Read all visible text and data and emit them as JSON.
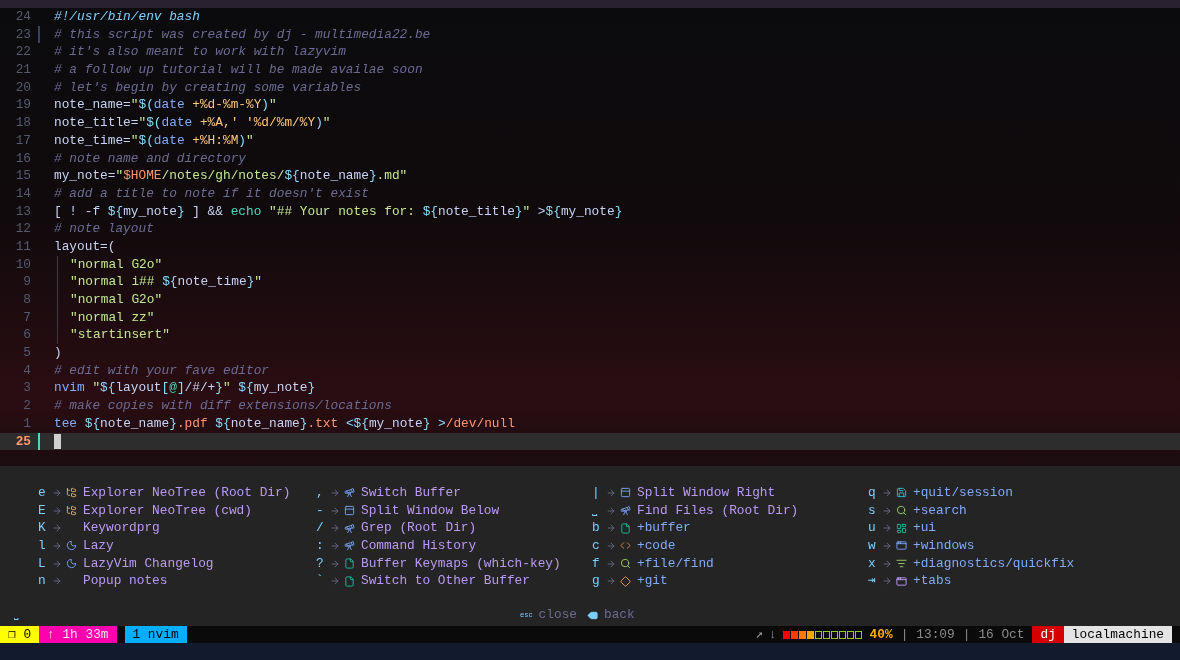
{
  "editor": {
    "lines": [
      {
        "number": "24",
        "tokens": [
          {
            "kind": "shebang",
            "text": "#!/usr/bin/env bash"
          }
        ]
      },
      {
        "number": "23",
        "sign": true,
        "tokens": [
          {
            "kind": "comment",
            "text": "# this script was created by dj - multimedia22.be"
          }
        ]
      },
      {
        "number": "22",
        "tokens": [
          {
            "kind": "comment",
            "text": "# it's also meant to work with lazyvim"
          }
        ]
      },
      {
        "number": "21",
        "tokens": [
          {
            "kind": "comment",
            "text": "# a follow up tutorial will be made availae soon"
          }
        ]
      },
      {
        "number": "20",
        "tokens": [
          {
            "kind": "comment",
            "text": "# let's begin by creating some variables"
          }
        ]
      },
      {
        "number": "19",
        "tokens": [
          {
            "kind": "ident",
            "text": "note_name="
          },
          {
            "kind": "string",
            "text": "\""
          },
          {
            "kind": "op",
            "text": "$("
          },
          {
            "kind": "command",
            "text": "date"
          },
          {
            "kind": "arg",
            "text": " +%d-%m-%Y"
          },
          {
            "kind": "op",
            "text": ")"
          },
          {
            "kind": "string",
            "text": "\""
          }
        ]
      },
      {
        "number": "18",
        "tokens": [
          {
            "kind": "ident",
            "text": "note_title="
          },
          {
            "kind": "string",
            "text": "\""
          },
          {
            "kind": "op",
            "text": "$("
          },
          {
            "kind": "command",
            "text": "date"
          },
          {
            "kind": "arg",
            "text": " +%A,' '%d/%m/%Y"
          },
          {
            "kind": "op",
            "text": ")"
          },
          {
            "kind": "string",
            "text": "\""
          }
        ]
      },
      {
        "number": "17",
        "tokens": [
          {
            "kind": "ident",
            "text": "note_time="
          },
          {
            "kind": "string",
            "text": "\""
          },
          {
            "kind": "op",
            "text": "$("
          },
          {
            "kind": "command",
            "text": "date"
          },
          {
            "kind": "arg",
            "text": " +%H:%M"
          },
          {
            "kind": "op",
            "text": ")"
          },
          {
            "kind": "string",
            "text": "\""
          }
        ]
      },
      {
        "number": "16",
        "tokens": [
          {
            "kind": "comment",
            "text": "# note name and directory"
          }
        ]
      },
      {
        "number": "15",
        "tokens": [
          {
            "kind": "ident",
            "text": "my_note="
          },
          {
            "kind": "string",
            "text": "\""
          },
          {
            "kind": "special",
            "text": "$HOME"
          },
          {
            "kind": "string",
            "text": "/notes/gh/notes/"
          },
          {
            "kind": "op",
            "text": "${"
          },
          {
            "kind": "ident",
            "text": "note_name"
          },
          {
            "kind": "op",
            "text": "}"
          },
          {
            "kind": "string",
            "text": ".md\""
          }
        ]
      },
      {
        "number": "14",
        "tokens": [
          {
            "kind": "comment",
            "text": "# add a title to note if it doesn't exist"
          }
        ]
      },
      {
        "number": "13",
        "tokens": [
          {
            "kind": "ident",
            "text": "[ ! -f "
          },
          {
            "kind": "op",
            "text": "${"
          },
          {
            "kind": "ident",
            "text": "my_note"
          },
          {
            "kind": "op",
            "text": "}"
          },
          {
            "kind": "ident",
            "text": " ] && "
          },
          {
            "kind": "builtin",
            "text": "echo"
          },
          {
            "kind": "string",
            "text": " \"## Your notes for: "
          },
          {
            "kind": "op",
            "text": "${"
          },
          {
            "kind": "ident",
            "text": "note_title"
          },
          {
            "kind": "op",
            "text": "}"
          },
          {
            "kind": "string",
            "text": "\""
          },
          {
            "kind": "ident",
            "text": " >"
          },
          {
            "kind": "op",
            "text": "${"
          },
          {
            "kind": "ident",
            "text": "my_note"
          },
          {
            "kind": "op",
            "text": "}"
          }
        ]
      },
      {
        "number": "12",
        "tokens": [
          {
            "kind": "comment",
            "text": "# note layout"
          }
        ]
      },
      {
        "number": "11",
        "tokens": [
          {
            "kind": "ident",
            "text": "layout=("
          }
        ]
      },
      {
        "number": "10",
        "indented": true,
        "tokens": [
          {
            "kind": "string",
            "text": "\"normal G2o\""
          }
        ]
      },
      {
        "number": "9",
        "indented": true,
        "tokens": [
          {
            "kind": "string",
            "text": "\"normal i## "
          },
          {
            "kind": "op",
            "text": "${"
          },
          {
            "kind": "ident",
            "text": "note_time"
          },
          {
            "kind": "op",
            "text": "}"
          },
          {
            "kind": "string",
            "text": "\""
          }
        ]
      },
      {
        "number": "8",
        "indented": true,
        "tokens": [
          {
            "kind": "string",
            "text": "\"normal G2o\""
          }
        ]
      },
      {
        "number": "7",
        "indented": true,
        "tokens": [
          {
            "kind": "string",
            "text": "\"normal zz\""
          }
        ]
      },
      {
        "number": "6",
        "indented": true,
        "tokens": [
          {
            "kind": "string",
            "text": "\"startinsert\""
          }
        ]
      },
      {
        "number": "5",
        "tokens": [
          {
            "kind": "ident",
            "text": ")"
          }
        ]
      },
      {
        "number": "4",
        "tokens": [
          {
            "kind": "comment",
            "text": "# edit with your fave editor"
          }
        ]
      },
      {
        "number": "3",
        "tokens": [
          {
            "kind": "command",
            "text": "nvim"
          },
          {
            "kind": "string",
            "text": " \""
          },
          {
            "kind": "op",
            "text": "${"
          },
          {
            "kind": "ident",
            "text": "layout"
          },
          {
            "kind": "op",
            "text": "["
          },
          {
            "kind": "builtin",
            "text": "@"
          },
          {
            "kind": "op",
            "text": "]"
          },
          {
            "kind": "ident",
            "text": "/#/+"
          },
          {
            "kind": "op",
            "text": "}"
          },
          {
            "kind": "string",
            "text": "\""
          },
          {
            "kind": "op",
            "text": " ${"
          },
          {
            "kind": "ident",
            "text": "my_note"
          },
          {
            "kind": "op",
            "text": "}"
          }
        ]
      },
      {
        "number": "2",
        "tokens": [
          {
            "kind": "comment",
            "text": "# make copies with diff extensions/locations"
          }
        ]
      },
      {
        "number": "1",
        "tokens": [
          {
            "kind": "command",
            "text": "tee"
          },
          {
            "kind": "op",
            "text": " ${"
          },
          {
            "kind": "ident",
            "text": "note_name"
          },
          {
            "kind": "op",
            "text": "}"
          },
          {
            "kind": "special",
            "text": ".pdf"
          },
          {
            "kind": "op",
            "text": " ${"
          },
          {
            "kind": "ident",
            "text": "note_name"
          },
          {
            "kind": "op",
            "text": "}"
          },
          {
            "kind": "special",
            "text": ".txt"
          },
          {
            "kind": "op",
            "text": " <${"
          },
          {
            "kind": "ident",
            "text": "my_note"
          },
          {
            "kind": "op",
            "text": "}"
          },
          {
            "kind": "op",
            "text": " >"
          },
          {
            "kind": "special",
            "text": "/dev/null"
          }
        ]
      },
      {
        "number": "25",
        "sign": true,
        "current": true
      }
    ]
  },
  "which_key": {
    "columns": [
      [
        {
          "key": "e",
          "label": "Explorer NeoTree (Root Dir)",
          "kind": "action"
        },
        {
          "key": "E",
          "label": "Explorer NeoTree (cwd)",
          "kind": "action"
        },
        {
          "key": "K",
          "label": "Keywordprg",
          "kind": "action"
        },
        {
          "key": "l",
          "label": "Lazy",
          "kind": "action"
        },
        {
          "key": "L",
          "label": "LazyVim Changelog",
          "kind": "action"
        },
        {
          "key": "n",
          "label": "Popup notes",
          "kind": "action"
        }
      ],
      [
        {
          "key": ",",
          "label": "Switch Buffer",
          "kind": "action"
        },
        {
          "key": "-",
          "label": "Split Window Below",
          "kind": "action"
        },
        {
          "key": "/",
          "label": "Grep (Root Dir)",
          "kind": "action"
        },
        {
          "key": ":",
          "label": "Command History",
          "kind": "action"
        },
        {
          "key": "?",
          "label": "Buffer Keymaps (which-key)",
          "kind": "action"
        },
        {
          "key": "`",
          "label": "Switch to Other Buffer",
          "kind": "action"
        }
      ],
      [
        {
          "key": "|",
          "label": "Split Window Right",
          "kind": "action"
        },
        {
          "key": "⎵",
          "label": "Find Files (Root Dir)",
          "kind": "action"
        },
        {
          "key": "b",
          "label": "+buffer",
          "kind": "group"
        },
        {
          "key": "c",
          "label": "+code",
          "kind": "group"
        },
        {
          "key": "f",
          "label": "+file/find",
          "kind": "group"
        },
        {
          "key": "g",
          "label": "+git",
          "kind": "group"
        }
      ],
      [
        {
          "key": "q",
          "label": "+quit/session",
          "kind": "group"
        },
        {
          "key": "s",
          "label": "+search",
          "kind": "group"
        },
        {
          "key": "u",
          "label": "+ui",
          "kind": "group"
        },
        {
          "key": "w",
          "label": "+windows",
          "kind": "group"
        },
        {
          "key": "x",
          "label": "+diagnostics/quickfix",
          "kind": "group"
        },
        {
          "key": "⇥",
          "label": "+tabs",
          "kind": "group"
        }
      ]
    ],
    "breadcrumb": "⎵",
    "footer": [
      {
        "key": "esc",
        "label": "close"
      },
      {
        "label": "back"
      }
    ]
  },
  "status_bar": {
    "left": [
      {
        "text": "❐ 0",
        "color": "#ffff00"
      },
      {
        "text": "↑ 1h 33m",
        "color": "#ff00af"
      },
      {
        "text": "1 nvim",
        "color": "#00afff"
      }
    ],
    "arrows": [
      "↗",
      "↓"
    ],
    "battery": {
      "level": 0.4,
      "reading": "40%"
    },
    "time": "13:09",
    "date": "16 Oct",
    "separators": [
      "|",
      "|"
    ],
    "user": "dj",
    "host": "localmachine"
  }
}
